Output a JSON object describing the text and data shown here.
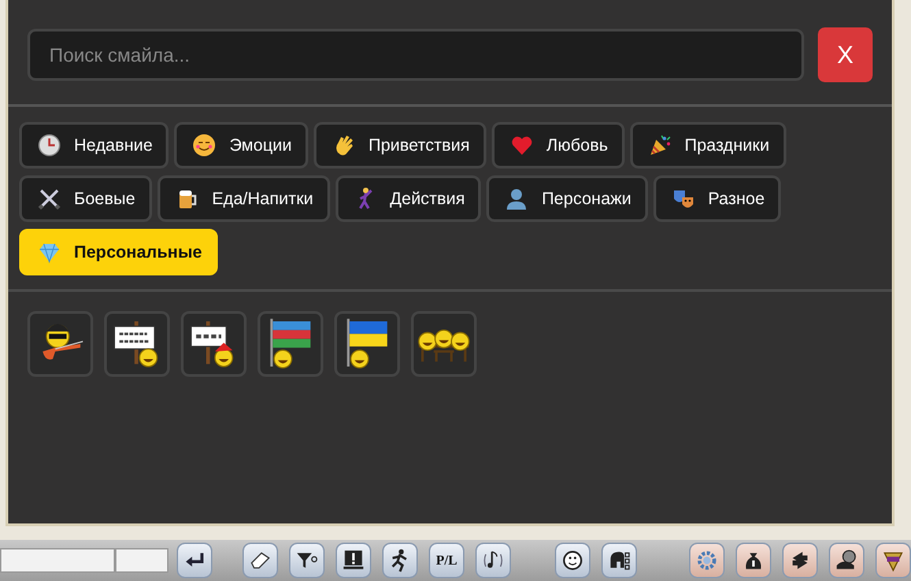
{
  "smiley_picker": {
    "search": {
      "placeholder": "Поиск смайла..."
    },
    "close_button": "X",
    "categories": [
      {
        "label": "Недавние",
        "selected": false
      },
      {
        "label": "Эмоции",
        "selected": false
      },
      {
        "label": "Приветствия",
        "selected": false
      },
      {
        "label": "Любовь",
        "selected": false
      },
      {
        "label": "Праздники",
        "selected": false
      },
      {
        "label": "Боевые",
        "selected": false
      },
      {
        "label": "Еда/Напитки",
        "selected": false
      },
      {
        "label": "Действия",
        "selected": false
      },
      {
        "label": "Персонажи",
        "selected": false
      },
      {
        "label": "Разное",
        "selected": false
      },
      {
        "label": "Персональные",
        "selected": true
      }
    ],
    "smileys": [
      {
        "kind": "guitar"
      },
      {
        "kind": "sign"
      },
      {
        "kind": "sign-santa"
      },
      {
        "kind": "flag-az"
      },
      {
        "kind": "flag-ua"
      },
      {
        "kind": "group"
      }
    ]
  },
  "toolbar": {
    "buttons": [
      {
        "kind": "icon"
      },
      {
        "kind": "icon"
      },
      {
        "kind": "icon"
      },
      {
        "kind": "icon"
      },
      {
        "kind": "icon"
      },
      {
        "kind": "text",
        "label": "P/L"
      },
      {
        "kind": "icon"
      },
      {
        "kind": "icon"
      },
      {
        "kind": "icon"
      },
      {
        "kind": "icon"
      },
      {
        "kind": "icon"
      },
      {
        "kind": "icon"
      },
      {
        "kind": "icon"
      },
      {
        "kind": "icon"
      }
    ]
  }
}
